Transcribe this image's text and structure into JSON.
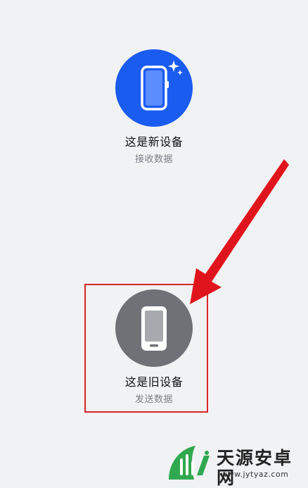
{
  "new_device": {
    "title": "这是新设备",
    "subtitle": "接收数据",
    "icon": "phone-sparkle-icon",
    "color": "#1a5cf0"
  },
  "old_device": {
    "title": "这是旧设备",
    "subtitle": "发送数据",
    "icon": "phone-icon",
    "color": "#6f7177"
  },
  "annotation": {
    "box_color": "#d8262b",
    "arrow_color": "#e0141c"
  },
  "watermark": {
    "brand": "天源安卓网",
    "url": "www.jytyaz.com"
  }
}
